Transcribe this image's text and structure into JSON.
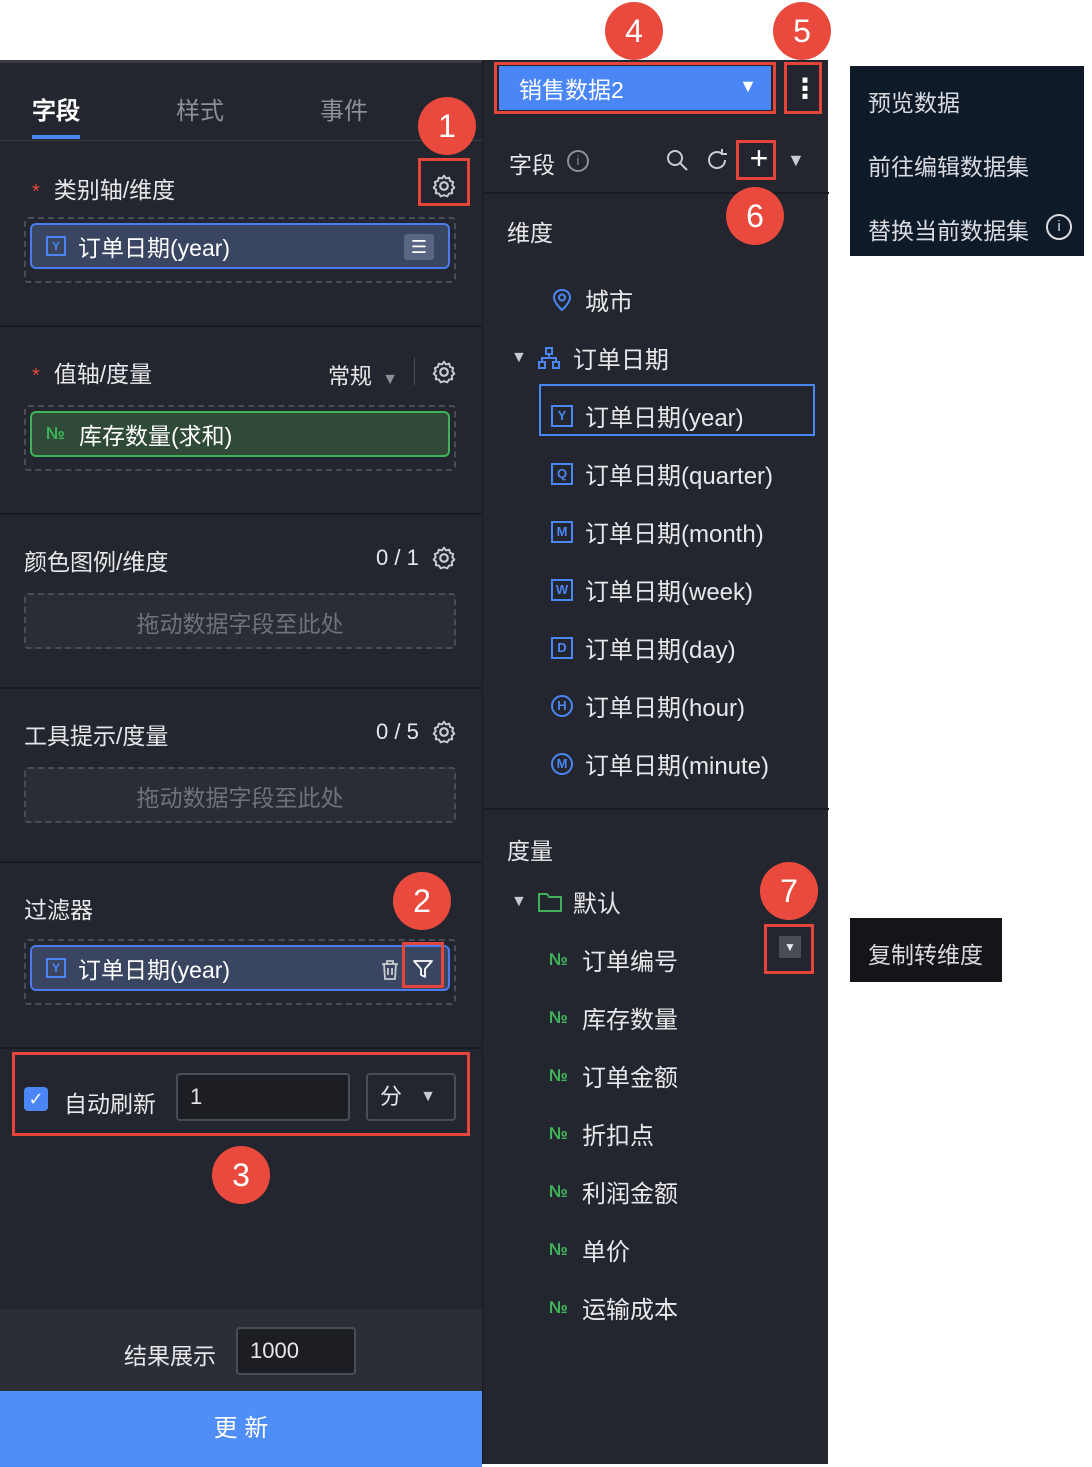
{
  "left_panel": {
    "tabs": [
      "字段",
      "样式",
      "事件"
    ],
    "category_axis": {
      "title": "类别轴/维度",
      "field": "订单日期(year)"
    },
    "value_axis": {
      "title": "值轴/度量",
      "mode": "常规",
      "field": "库存数量(求和)"
    },
    "color_legend": {
      "title": "颜色图例/维度",
      "count": "0 / 1",
      "placeholder": "拖动数据字段至此处"
    },
    "tooltip": {
      "title": "工具提示/度量",
      "count": "0 / 5",
      "placeholder": "拖动数据字段至此处"
    },
    "filter": {
      "title": "过滤器",
      "field": "订单日期(year)"
    },
    "auto_refresh": {
      "label": "自动刷新",
      "checked": true,
      "value": "1",
      "unit": "分"
    },
    "result": {
      "label": "结果展示",
      "value": "1000"
    },
    "update_button": "更 新"
  },
  "right_panel": {
    "dataset": "销售数据2",
    "fields_label": "字段",
    "dimensions_label": "维度",
    "dimensions": [
      {
        "label": "城市",
        "icon": "location-icon"
      },
      {
        "label": "订单日期",
        "icon": "hierarchy-icon"
      },
      {
        "label": "订单日期(year)",
        "icon_letter": "Y"
      },
      {
        "label": "订单日期(quarter)",
        "icon_letter": "Q"
      },
      {
        "label": "订单日期(month)",
        "icon_letter": "M"
      },
      {
        "label": "订单日期(week)",
        "icon_letter": "W"
      },
      {
        "label": "订单日期(day)",
        "icon_letter": "D"
      },
      {
        "label": "订单日期(hour)",
        "icon_letter": "H"
      },
      {
        "label": "订单日期(minute)",
        "icon_letter": "M"
      }
    ],
    "measures_label": "度量",
    "measure_folder": "默认",
    "measures": [
      "订单编号",
      "库存数量",
      "订单金额",
      "折扣点",
      "利润金额",
      "单价",
      "运输成本"
    ],
    "number_icon_text": "№"
  },
  "more_menu": [
    "预览数据",
    "前往编辑数据集",
    "替换当前数据集"
  ],
  "field_menu": [
    "复制转维度"
  ],
  "badges": [
    "1",
    "2",
    "3",
    "4",
    "5",
    "6",
    "7"
  ],
  "colors": {
    "panel_bg": "#23262e",
    "accent": "#4a86f5",
    "annotation_red": "#ea4a3e",
    "measure_green": "#3fb25a"
  }
}
